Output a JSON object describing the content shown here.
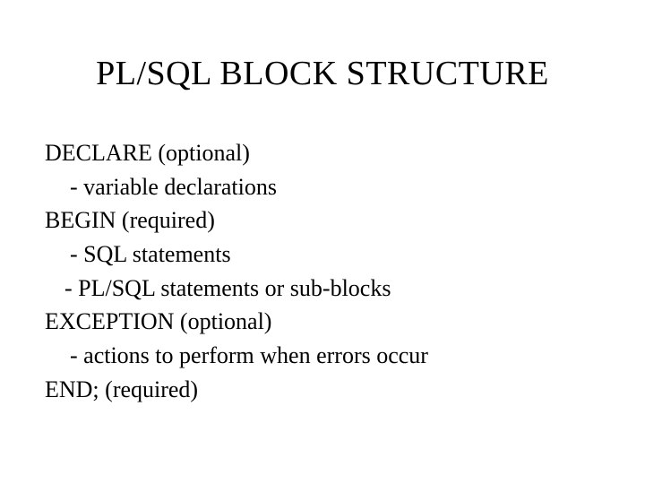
{
  "title": "PL/SQL BLOCK STRUCTURE",
  "lines": {
    "l0": "DECLARE (optional)",
    "l1": "- variable declarations",
    "l2": "BEGIN (required)",
    "l3": "- SQL statements",
    "l4": "- PL/SQL statements or sub-blocks",
    "l5": "EXCEPTION (optional)",
    "l6": "- actions to perform when errors occur",
    "l7": "END;  (required)"
  }
}
